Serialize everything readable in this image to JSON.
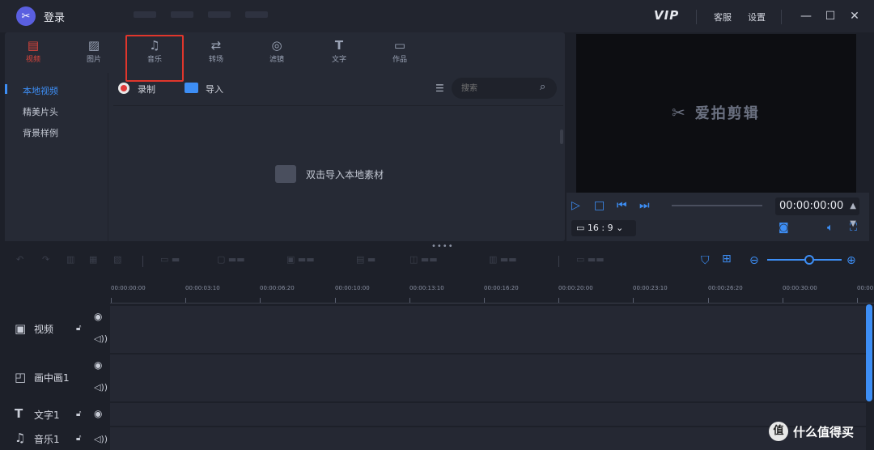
{
  "titlebar": {
    "login": "登录",
    "vip": "VIP",
    "customer_service": "客服",
    "settings": "设置",
    "minimize": "—",
    "maximize": "☐",
    "close": "✕"
  },
  "category_tabs": [
    {
      "label": "视频",
      "icon": "film-icon",
      "glyph": "▤",
      "active": true
    },
    {
      "label": "图片",
      "icon": "image-icon",
      "glyph": "▨",
      "active": false
    },
    {
      "label": "音乐",
      "icon": "music-icon",
      "glyph": "♫",
      "active": false
    },
    {
      "label": "转场",
      "icon": "transition-icon",
      "glyph": "⇄",
      "active": false
    },
    {
      "label": "滤镜",
      "icon": "filter-icon",
      "glyph": "◎",
      "active": false
    },
    {
      "label": "文字",
      "icon": "text-icon",
      "glyph": "T",
      "active": false
    },
    {
      "label": "作品",
      "icon": "folder-icon",
      "glyph": "▭",
      "active": false
    }
  ],
  "side_nav": [
    {
      "label": "本地视频",
      "active": true
    },
    {
      "label": "精美片头",
      "active": false
    },
    {
      "label": "背景样例",
      "active": false
    }
  ],
  "media": {
    "record_label": "录制",
    "import_label": "导入",
    "search_placeholder": "搜索",
    "empty_hint": "双击导入本地素材"
  },
  "preview": {
    "brand": "爱拍剪辑",
    "timecode": "00:00:00:00",
    "aspect_ratio": "16 : 9"
  },
  "timeline": {
    "ticks": [
      "00:00:00:00",
      "00:00:03:10",
      "00:00:06:20",
      "00:00:10:00",
      "00:00:13:10",
      "00:00:16:20",
      "00:00:20:00",
      "00:00:23:10",
      "00:00:26:20",
      "00:00:30:00",
      "00:00:3"
    ],
    "tracks": [
      {
        "label": "视频",
        "icon": "film-track-icon"
      },
      {
        "label": "画中画1",
        "icon": "pip-track-icon"
      },
      {
        "label": "文字1",
        "icon": "text-track-icon"
      },
      {
        "label": "音乐1",
        "icon": "music-track-icon"
      }
    ]
  },
  "watermark": {
    "badge": "值",
    "text": "什么值得买"
  },
  "colors": {
    "accent": "#3d8ef5",
    "active_tab": "#e0463c",
    "highlight_box": "#e0362c"
  }
}
